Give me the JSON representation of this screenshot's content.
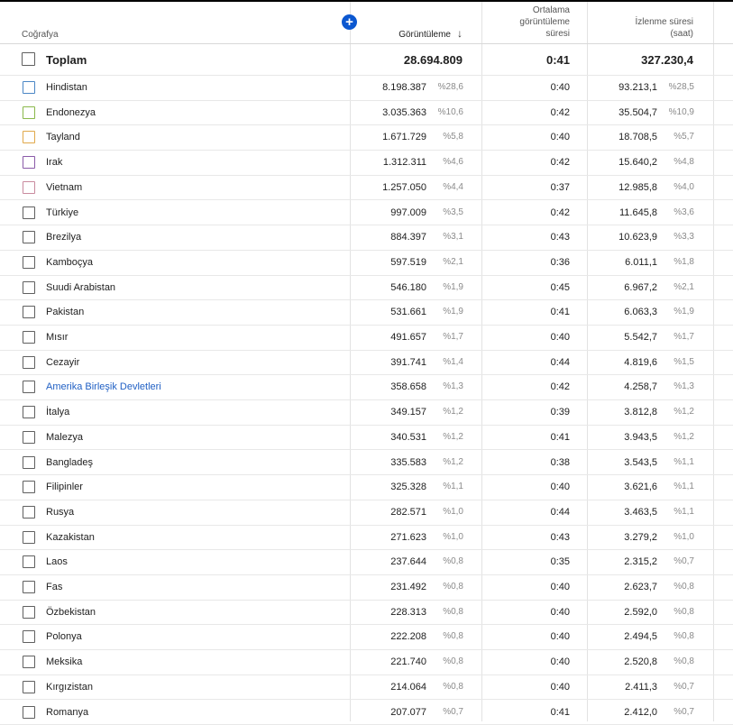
{
  "header": {
    "geo": "Coğrafya",
    "views": "Görüntüleme",
    "sort_icon": "arrow-down-icon",
    "avg_line1": "Ortalama",
    "avg_line2": "görüntüleme",
    "avg_line3": "süresi",
    "time_line1": "İzlenme süresi",
    "time_line2": "(saat)",
    "add_icon": "plus-icon"
  },
  "colors": {
    "accent": "#0b57d0",
    "link": "#2160c4"
  },
  "total": {
    "label": "Toplam",
    "views": "28.694.809",
    "avg": "0:41",
    "time": "327.230,4"
  },
  "rows": [
    {
      "name": "Hindistan",
      "views": "8.198.387",
      "vpct": "%28,6",
      "avg": "0:40",
      "time": "93.213,1",
      "tpct": "%28,5",
      "color": "#4a86c5"
    },
    {
      "name": "Endonezya",
      "views": "3.035.363",
      "vpct": "%10,6",
      "avg": "0:42",
      "time": "35.504,7",
      "tpct": "%10,9",
      "color": "#8ab84a"
    },
    {
      "name": "Tayland",
      "views": "1.671.729",
      "vpct": "%5,8",
      "avg": "0:40",
      "time": "18.708,5",
      "tpct": "%5,7",
      "color": "#e0a84a"
    },
    {
      "name": "Irak",
      "views": "1.312.311",
      "vpct": "%4,6",
      "avg": "0:42",
      "time": "15.640,2",
      "tpct": "%4,8",
      "color": "#8a5aa8"
    },
    {
      "name": "Vietnam",
      "views": "1.257.050",
      "vpct": "%4,4",
      "avg": "0:37",
      "time": "12.985,8",
      "tpct": "%4,0",
      "color": "#c98a9e"
    },
    {
      "name": "Türkiye",
      "views": "997.009",
      "vpct": "%3,5",
      "avg": "0:42",
      "time": "11.645,8",
      "tpct": "%3,6"
    },
    {
      "name": "Brezilya",
      "views": "884.397",
      "vpct": "%3,1",
      "avg": "0:43",
      "time": "10.623,9",
      "tpct": "%3,3"
    },
    {
      "name": "Kamboçya",
      "views": "597.519",
      "vpct": "%2,1",
      "avg": "0:36",
      "time": "6.011,1",
      "tpct": "%1,8"
    },
    {
      "name": "Suudi Arabistan",
      "views": "546.180",
      "vpct": "%1,9",
      "avg": "0:45",
      "time": "6.967,2",
      "tpct": "%2,1"
    },
    {
      "name": "Pakistan",
      "views": "531.661",
      "vpct": "%1,9",
      "avg": "0:41",
      "time": "6.063,3",
      "tpct": "%1,9"
    },
    {
      "name": "Mısır",
      "views": "491.657",
      "vpct": "%1,7",
      "avg": "0:40",
      "time": "5.542,7",
      "tpct": "%1,7"
    },
    {
      "name": "Cezayir",
      "views": "391.741",
      "vpct": "%1,4",
      "avg": "0:44",
      "time": "4.819,6",
      "tpct": "%1,5"
    },
    {
      "name": "Amerika Birleşik Devletleri",
      "views": "358.658",
      "vpct": "%1,3",
      "avg": "0:42",
      "time": "4.258,7",
      "tpct": "%1,3",
      "link": true
    },
    {
      "name": "İtalya",
      "views": "349.157",
      "vpct": "%1,2",
      "avg": "0:39",
      "time": "3.812,8",
      "tpct": "%1,2"
    },
    {
      "name": "Malezya",
      "views": "340.531",
      "vpct": "%1,2",
      "avg": "0:41",
      "time": "3.943,5",
      "tpct": "%1,2"
    },
    {
      "name": "Bangladeş",
      "views": "335.583",
      "vpct": "%1,2",
      "avg": "0:38",
      "time": "3.543,5",
      "tpct": "%1,1"
    },
    {
      "name": "Filipinler",
      "views": "325.328",
      "vpct": "%1,1",
      "avg": "0:40",
      "time": "3.621,6",
      "tpct": "%1,1"
    },
    {
      "name": "Rusya",
      "views": "282.571",
      "vpct": "%1,0",
      "avg": "0:44",
      "time": "3.463,5",
      "tpct": "%1,1"
    },
    {
      "name": "Kazakistan",
      "views": "271.623",
      "vpct": "%1,0",
      "avg": "0:43",
      "time": "3.279,2",
      "tpct": "%1,0"
    },
    {
      "name": "Laos",
      "views": "237.644",
      "vpct": "%0,8",
      "avg": "0:35",
      "time": "2.315,2",
      "tpct": "%0,7"
    },
    {
      "name": "Fas",
      "views": "231.492",
      "vpct": "%0,8",
      "avg": "0:40",
      "time": "2.623,7",
      "tpct": "%0,8"
    },
    {
      "name": "Özbekistan",
      "views": "228.313",
      "vpct": "%0,8",
      "avg": "0:40",
      "time": "2.592,0",
      "tpct": "%0,8"
    },
    {
      "name": "Polonya",
      "views": "222.208",
      "vpct": "%0,8",
      "avg": "0:40",
      "time": "2.494,5",
      "tpct": "%0,8"
    },
    {
      "name": "Meksika",
      "views": "221.740",
      "vpct": "%0,8",
      "avg": "0:40",
      "time": "2.520,8",
      "tpct": "%0,8"
    },
    {
      "name": "Kırgızistan",
      "views": "214.064",
      "vpct": "%0,8",
      "avg": "0:40",
      "time": "2.411,3",
      "tpct": "%0,7"
    },
    {
      "name": "Romanya",
      "views": "207.077",
      "vpct": "%0,7",
      "avg": "0:41",
      "time": "2.412,0",
      "tpct": "%0,7"
    }
  ]
}
